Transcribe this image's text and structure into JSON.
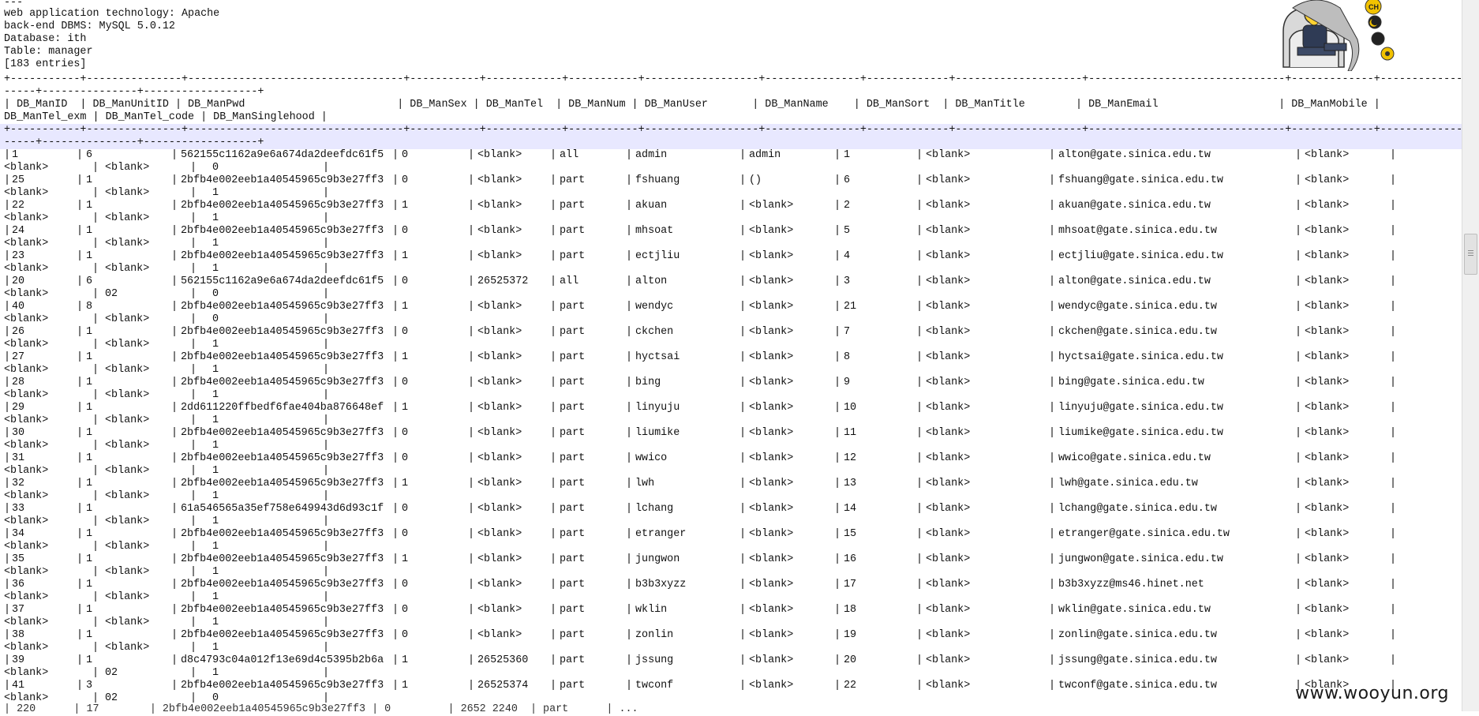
{
  "header": {
    "lines": [
      "---",
      "web application technology: Apache",
      "back-end DBMS: MySQL 5.0.12",
      "Database: ith",
      "Table: manager",
      "[183 entries]"
    ]
  },
  "separators": {
    "top_a": "+-----------+---------------+----------------------------------+-----------+------------+-----------+------------------+---------------+-------------+--------------------+-------------------------------+-------------+---------------",
    "top_b": "-----+---------------+------------------+"
  },
  "column_header": {
    "line1": "| DB_ManID  | DB_ManUnitID | DB_ManPwd                        | DB_ManSex | DB_ManTel  | DB_ManNum | DB_ManUser       | DB_ManName    | DB_ManSort  | DB_ManTitle        | DB_ManEmail                   | DB_ManMobile |",
    "line2": "DB_ManTel_exm | DB_ManTel_code | DB_ManSinglehood |"
  },
  "rows": [
    {
      "id": "1",
      "unit": "6",
      "pwd": "562155c1162a9e6a674da2deefdc61f5",
      "sex": "0",
      "tel": "<blank>",
      "num": "all",
      "user": "admin",
      "name": "admin",
      "sort": "1",
      "title": "<blank>",
      "email": "alton@gate.sinica.edu.tw",
      "mobile": "<blank>",
      "exm": "<blank>",
      "code": "<blank>",
      "single": "0"
    },
    {
      "id": "25",
      "unit": "1",
      "pwd": "2bfb4e002eeb1a40545965c9b3e27ff3",
      "sex": "0",
      "tel": "<blank>",
      "num": "part",
      "user": "fshuang",
      "name": "()",
      "sort": "6",
      "title": "<blank>",
      "email": "fshuang@gate.sinica.edu.tw",
      "mobile": "<blank>",
      "exm": "<blank>",
      "code": "<blank>",
      "single": "1"
    },
    {
      "id": "22",
      "unit": "1",
      "pwd": "2bfb4e002eeb1a40545965c9b3e27ff3",
      "sex": "1",
      "tel": "<blank>",
      "num": "part",
      "user": "akuan",
      "name": "<blank>",
      "sort": "2",
      "title": "<blank>",
      "email": "akuan@gate.sinica.edu.tw",
      "mobile": "<blank>",
      "exm": "<blank>",
      "code": "<blank>",
      "single": "1"
    },
    {
      "id": "24",
      "unit": "1",
      "pwd": "2bfb4e002eeb1a40545965c9b3e27ff3",
      "sex": "0",
      "tel": "<blank>",
      "num": "part",
      "user": "mhsoat",
      "name": "<blank>",
      "sort": "5",
      "title": "<blank>",
      "email": "mhsoat@gate.sinica.edu.tw",
      "mobile": "<blank>",
      "exm": "<blank>",
      "code": "<blank>",
      "single": "1"
    },
    {
      "id": "23",
      "unit": "1",
      "pwd": "2bfb4e002eeb1a40545965c9b3e27ff3",
      "sex": "1",
      "tel": "<blank>",
      "num": "part",
      "user": "ectjliu",
      "name": "<blank>",
      "sort": "4",
      "title": "<blank>",
      "email": "ectjliu@gate.sinica.edu.tw",
      "mobile": "<blank>",
      "exm": "<blank>",
      "code": "<blank>",
      "single": "1"
    },
    {
      "id": "20",
      "unit": "6",
      "pwd": "562155c1162a9e6a674da2deefdc61f5",
      "sex": "0",
      "tel": "26525372",
      "num": "all",
      "user": "alton",
      "name": "<blank>",
      "sort": "3",
      "title": "<blank>",
      "email": "alton@gate.sinica.edu.tw",
      "mobile": "<blank>",
      "exm": "<blank>",
      "code": "02",
      "single": "0"
    },
    {
      "id": "40",
      "unit": "8",
      "pwd": "2bfb4e002eeb1a40545965c9b3e27ff3",
      "sex": "1",
      "tel": "<blank>",
      "num": "part",
      "user": "wendyc",
      "name": "<blank>",
      "sort": "21",
      "title": "<blank>",
      "email": "wendyc@gate.sinica.edu.tw",
      "mobile": "<blank>",
      "exm": "<blank>",
      "code": "<blank>",
      "single": "0"
    },
    {
      "id": "26",
      "unit": "1",
      "pwd": "2bfb4e002eeb1a40545965c9b3e27ff3",
      "sex": "0",
      "tel": "<blank>",
      "num": "part",
      "user": "ckchen",
      "name": "<blank>",
      "sort": "7",
      "title": "<blank>",
      "email": "ckchen@gate.sinica.edu.tw",
      "mobile": "<blank>",
      "exm": "<blank>",
      "code": "<blank>",
      "single": "1"
    },
    {
      "id": "27",
      "unit": "1",
      "pwd": "2bfb4e002eeb1a40545965c9b3e27ff3",
      "sex": "1",
      "tel": "<blank>",
      "num": "part",
      "user": "hyctsai",
      "name": "<blank>",
      "sort": "8",
      "title": "<blank>",
      "email": "hyctsai@gate.sinica.edu.tw",
      "mobile": "<blank>",
      "exm": "<blank>",
      "code": "<blank>",
      "single": "1"
    },
    {
      "id": "28",
      "unit": "1",
      "pwd": "2bfb4e002eeb1a40545965c9b3e27ff3",
      "sex": "0",
      "tel": "<blank>",
      "num": "part",
      "user": "bing",
      "name": "<blank>",
      "sort": "9",
      "title": "<blank>",
      "email": "bing@gate.sinica.edu.tw",
      "mobile": "<blank>",
      "exm": "<blank>",
      "code": "<blank>",
      "single": "1"
    },
    {
      "id": "29",
      "unit": "1",
      "pwd": "2dd611220ffbedf6fae404ba876648ef",
      "sex": "1",
      "tel": "<blank>",
      "num": "part",
      "user": "linyuju",
      "name": "<blank>",
      "sort": "10",
      "title": "<blank>",
      "email": "linyuju@gate.sinica.edu.tw",
      "mobile": "<blank>",
      "exm": "<blank>",
      "code": "<blank>",
      "single": "1"
    },
    {
      "id": "30",
      "unit": "1",
      "pwd": "2bfb4e002eeb1a40545965c9b3e27ff3",
      "sex": "0",
      "tel": "<blank>",
      "num": "part",
      "user": "liumike",
      "name": "<blank>",
      "sort": "11",
      "title": "<blank>",
      "email": "liumike@gate.sinica.edu.tw",
      "mobile": "<blank>",
      "exm": "<blank>",
      "code": "<blank>",
      "single": "1"
    },
    {
      "id": "31",
      "unit": "1",
      "pwd": "2bfb4e002eeb1a40545965c9b3e27ff3",
      "sex": "0",
      "tel": "<blank>",
      "num": "part",
      "user": "wwico",
      "name": "<blank>",
      "sort": "12",
      "title": "<blank>",
      "email": "wwico@gate.sinica.edu.tw",
      "mobile": "<blank>",
      "exm": "<blank>",
      "code": "<blank>",
      "single": "1"
    },
    {
      "id": "32",
      "unit": "1",
      "pwd": "2bfb4e002eeb1a40545965c9b3e27ff3",
      "sex": "1",
      "tel": "<blank>",
      "num": "part",
      "user": "lwh",
      "name": "<blank>",
      "sort": "13",
      "title": "<blank>",
      "email": "lwh@gate.sinica.edu.tw",
      "mobile": "<blank>",
      "exm": "<blank>",
      "code": "<blank>",
      "single": "1"
    },
    {
      "id": "33",
      "unit": "1",
      "pwd": "61a546565a35ef758e649943d6d93c1f",
      "sex": "0",
      "tel": "<blank>",
      "num": "part",
      "user": "lchang",
      "name": "<blank>",
      "sort": "14",
      "title": "<blank>",
      "email": "lchang@gate.sinica.edu.tw",
      "mobile": "<blank>",
      "exm": "<blank>",
      "code": "<blank>",
      "single": "1"
    },
    {
      "id": "34",
      "unit": "1",
      "pwd": "2bfb4e002eeb1a40545965c9b3e27ff3",
      "sex": "0",
      "tel": "<blank>",
      "num": "part",
      "user": "etranger",
      "name": "<blank>",
      "sort": "15",
      "title": "<blank>",
      "email": "etranger@gate.sinica.edu.tw",
      "mobile": "<blank>",
      "exm": "<blank>",
      "code": "<blank>",
      "single": "1"
    },
    {
      "id": "35",
      "unit": "1",
      "pwd": "2bfb4e002eeb1a40545965c9b3e27ff3",
      "sex": "1",
      "tel": "<blank>",
      "num": "part",
      "user": "jungwon",
      "name": "<blank>",
      "sort": "16",
      "title": "<blank>",
      "email": "jungwon@gate.sinica.edu.tw",
      "mobile": "<blank>",
      "exm": "<blank>",
      "code": "<blank>",
      "single": "1"
    },
    {
      "id": "36",
      "unit": "1",
      "pwd": "2bfb4e002eeb1a40545965c9b3e27ff3",
      "sex": "0",
      "tel": "<blank>",
      "num": "part",
      "user": "b3b3xyzz",
      "name": "<blank>",
      "sort": "17",
      "title": "<blank>",
      "email": "b3b3xyzz@ms46.hinet.net",
      "mobile": "<blank>",
      "exm": "<blank>",
      "code": "<blank>",
      "single": "1"
    },
    {
      "id": "37",
      "unit": "1",
      "pwd": "2bfb4e002eeb1a40545965c9b3e27ff3",
      "sex": "0",
      "tel": "<blank>",
      "num": "part",
      "user": "wklin",
      "name": "<blank>",
      "sort": "18",
      "title": "<blank>",
      "email": "wklin@gate.sinica.edu.tw",
      "mobile": "<blank>",
      "exm": "<blank>",
      "code": "<blank>",
      "single": "1"
    },
    {
      "id": "38",
      "unit": "1",
      "pwd": "2bfb4e002eeb1a40545965c9b3e27ff3",
      "sex": "0",
      "tel": "<blank>",
      "num": "part",
      "user": "zonlin",
      "name": "<blank>",
      "sort": "19",
      "title": "<blank>",
      "email": "zonlin@gate.sinica.edu.tw",
      "mobile": "<blank>",
      "exm": "<blank>",
      "code": "<blank>",
      "single": "1"
    },
    {
      "id": "39",
      "unit": "1",
      "pwd": "d8c4793c04a012f13e69d4c5395b2b6a",
      "sex": "1",
      "tel": "26525360",
      "num": "part",
      "user": "jssung",
      "name": "<blank>",
      "sort": "20",
      "title": "<blank>",
      "email": "jssung@gate.sinica.edu.tw",
      "mobile": "<blank>",
      "exm": "<blank>",
      "code": "02",
      "single": "1"
    },
    {
      "id": "41",
      "unit": "3",
      "pwd": "2bfb4e002eeb1a40545965c9b3e27ff3",
      "sex": "1",
      "tel": "26525374",
      "num": "part",
      "user": "twconf",
      "name": "<blank>",
      "sort": "22",
      "title": "<blank>",
      "email": "twconf@gate.sinica.edu.tw",
      "mobile": "<blank>",
      "exm": "<blank>",
      "code": "02",
      "single": "0"
    }
  ],
  "watermark": "www.wooyun.org",
  "mascot_badges": [
    "CH"
  ],
  "colors": {
    "highlight": "#e8e8ff",
    "badge": "#f2c200"
  }
}
